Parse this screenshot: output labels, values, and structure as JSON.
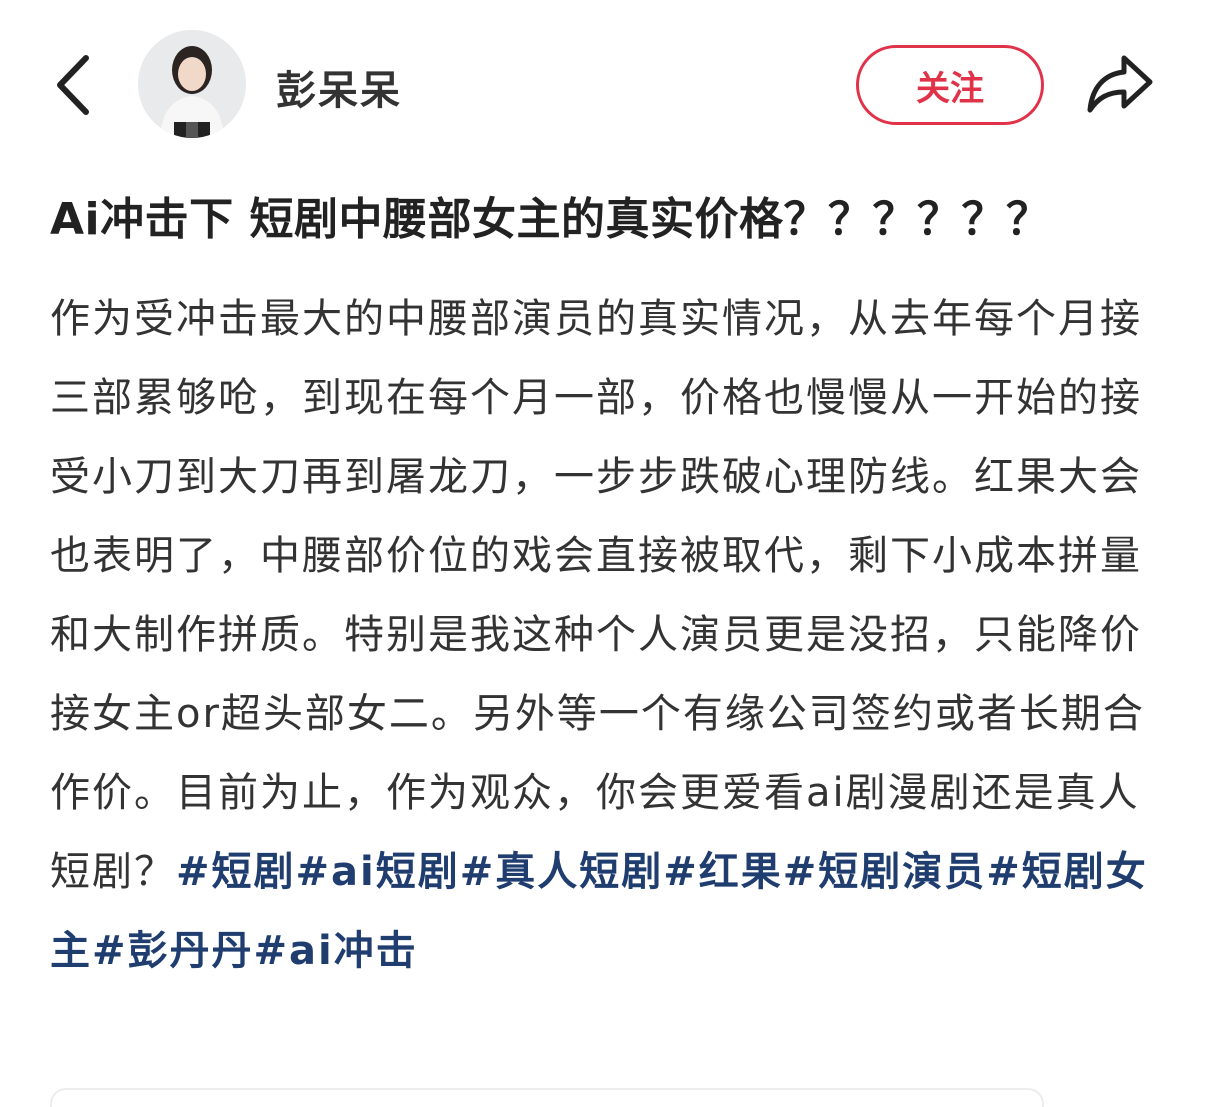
{
  "header": {
    "author_name": "彭呆呆",
    "follow_label": "关注",
    "back_icon": "chevron-left-icon",
    "share_icon": "share-arrow-icon",
    "accent_color": "#e0334a"
  },
  "post": {
    "title": "Ai冲击下 短剧中腰部女主的真实价格？？？？？？",
    "body": "作为受冲击最大的中腰部演员的真实情况，从去年每个月接三部累够呛，到现在每个月一部，价格也慢慢从一开始的接受小刀到大刀再到屠龙刀，一步步跌破心理防线。红果大会也表明了，中腰部价位的戏会直接被取代，剩下小成本拼量和大制作拼质。特别是我这种个人演员更是没招，只能降价接女主or超头部女二。另外等一个有缘公司签约或者长期合作价。目前为止，作为观众，你会更爱看ai剧漫剧还是真人短剧？",
    "hashtags": [
      "#短剧",
      "#ai短剧",
      "#真人短剧",
      "#红果",
      "#短剧演员",
      "#短剧女主",
      "#彭丹丹",
      "#ai冲击"
    ],
    "hashtag_color": "#1f3d6e"
  }
}
